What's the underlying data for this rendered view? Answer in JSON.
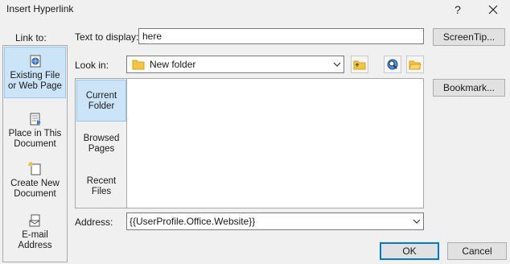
{
  "window": {
    "title": "Insert Hyperlink",
    "help_glyph": "?"
  },
  "link_to": {
    "label": "Link to:",
    "items": [
      {
        "line1": "Existing File",
        "line2": "or Web Page",
        "icon": "existing-file-icon"
      },
      {
        "line1": "Place in This",
        "line2": "Document",
        "icon": "place-in-document-icon"
      },
      {
        "line1": "Create New",
        "line2": "Document",
        "icon": "new-document-icon"
      },
      {
        "line1": "E-mail",
        "line2": "Address",
        "icon": "email-icon"
      }
    ],
    "selected_index": 0
  },
  "text_to_display": {
    "label": "Text to display:",
    "value": "here"
  },
  "screentip_button": "ScreenTip...",
  "look_in": {
    "label": "Look in:",
    "value": "New folder"
  },
  "nav": {
    "items": [
      {
        "line1": "Current",
        "line2": "Folder"
      },
      {
        "line1": "Browsed",
        "line2": "Pages"
      },
      {
        "line1": "Recent",
        "line2": "Files"
      }
    ],
    "selected_index": 0
  },
  "bookmark_button": "Bookmark...",
  "address": {
    "label": "Address:",
    "value": "{{UserProfile.Office.Website}}"
  },
  "ok_button": "OK",
  "cancel_button": "Cancel",
  "colors": {
    "selection_bg": "#cce4f7",
    "selection_border": "#99c9ef",
    "folder_yellow": "#f5c542",
    "default_button_border": "#0078d7"
  }
}
